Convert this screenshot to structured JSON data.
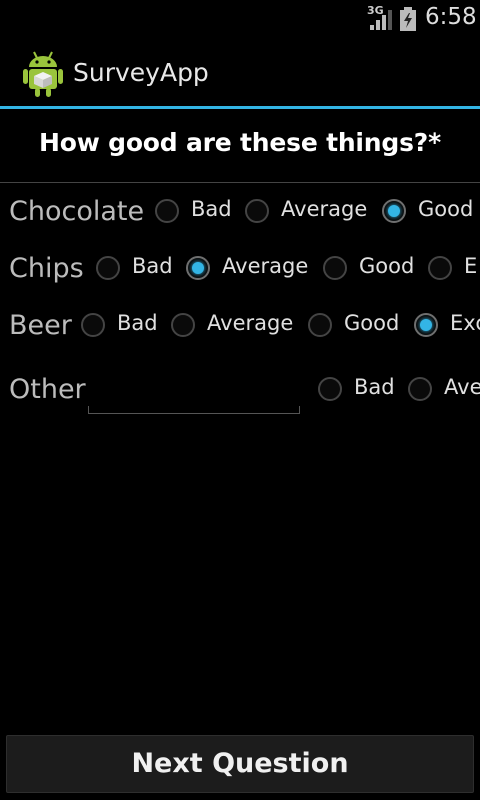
{
  "status_bar": {
    "network": "3G",
    "time": "6:58",
    "icons": [
      "signal-icon",
      "battery-icon"
    ]
  },
  "action_bar": {
    "app_title": "SurveyApp",
    "icon": "android-app-icon",
    "accent_color": "#33b5e5"
  },
  "question": {
    "text": "How good are these things?*"
  },
  "rows": [
    {
      "label": "Chocolate",
      "options": [
        {
          "label": "Bad",
          "checked": false
        },
        {
          "label": "Average",
          "checked": false
        },
        {
          "label": "Good",
          "checked": true
        }
      ]
    },
    {
      "label": "Chips",
      "options": [
        {
          "label": "Bad",
          "checked": false
        },
        {
          "label": "Average",
          "checked": true
        },
        {
          "label": "Good",
          "checked": false
        },
        {
          "label": "E",
          "checked": false
        }
      ]
    },
    {
      "label": "Beer",
      "options": [
        {
          "label": "Bad",
          "checked": false
        },
        {
          "label": "Average",
          "checked": false
        },
        {
          "label": "Good",
          "checked": false
        },
        {
          "label": "Exc",
          "checked": true
        }
      ]
    },
    {
      "label": "Other",
      "input_value": "",
      "options": [
        {
          "label": "Bad",
          "checked": false
        },
        {
          "label": "Ave",
          "checked": false
        }
      ]
    }
  ],
  "footer": {
    "next_label": "Next Question"
  }
}
